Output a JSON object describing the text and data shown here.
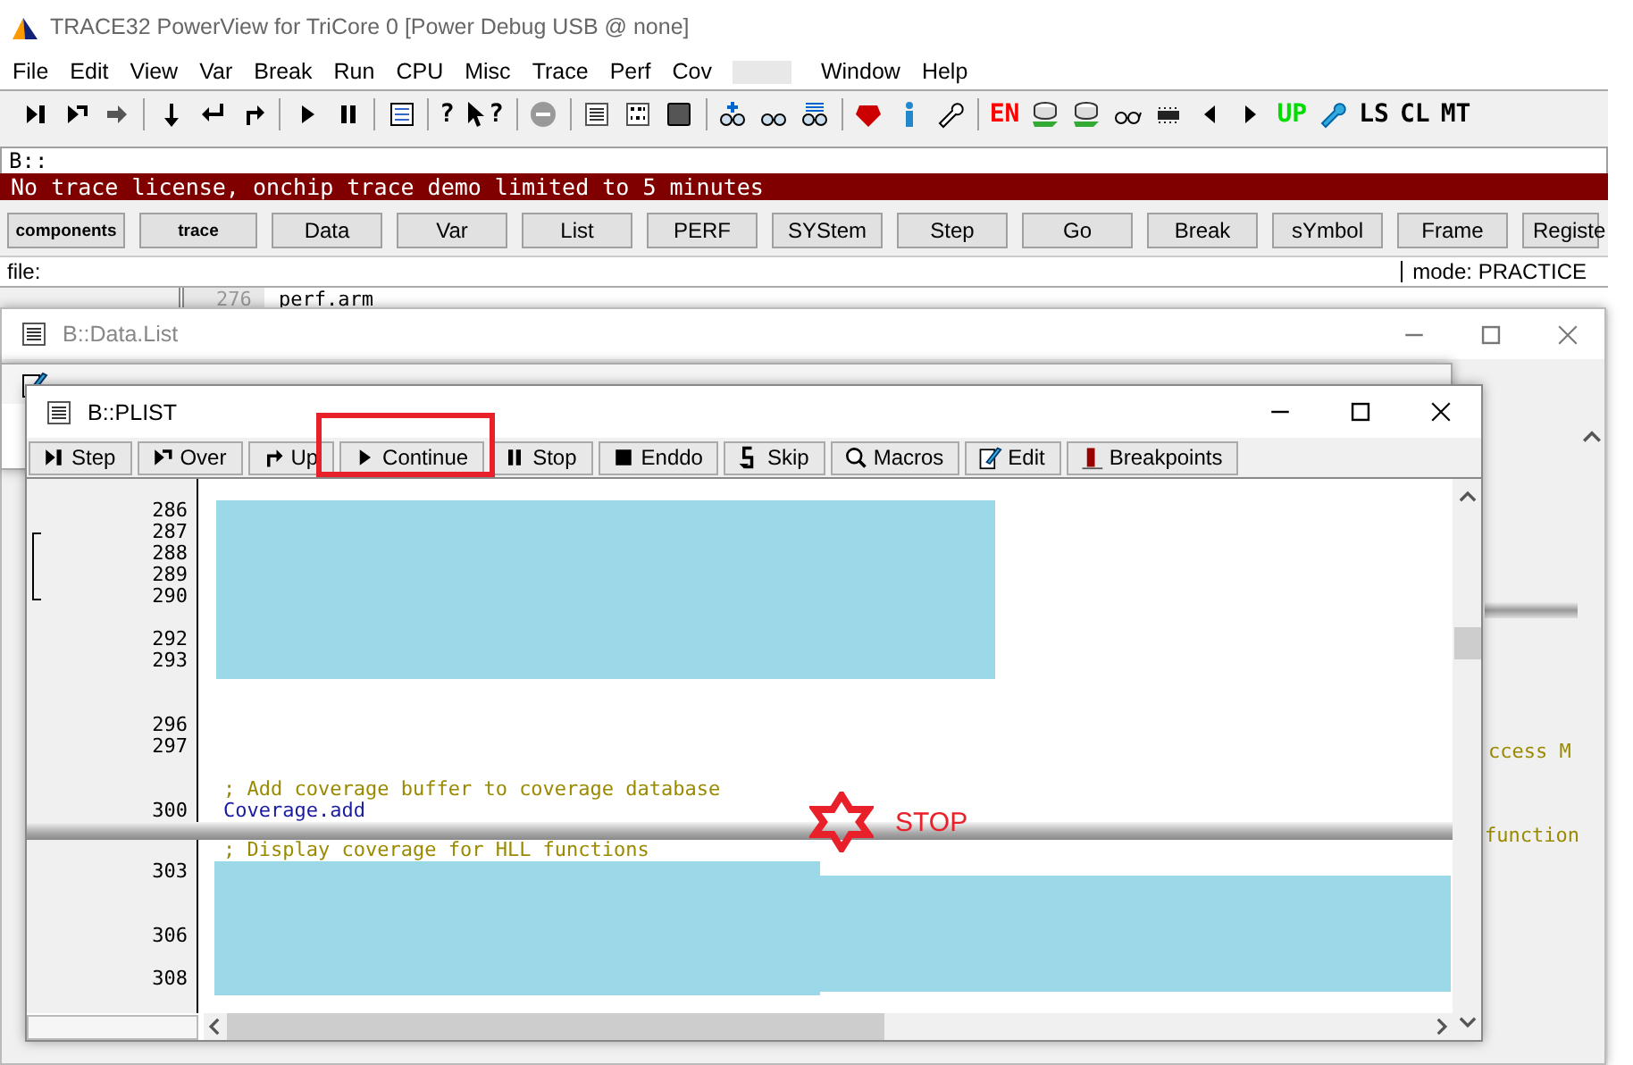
{
  "window": {
    "title": "TRACE32 PowerView for TriCore 0 [Power Debug USB @ none]"
  },
  "menu": [
    {
      "kind": "text",
      "label": "File"
    },
    {
      "kind": "text",
      "label": "Edit"
    },
    {
      "kind": "text",
      "label": "View"
    },
    {
      "kind": "text",
      "label": "Var"
    },
    {
      "kind": "text",
      "label": "Break"
    },
    {
      "kind": "text",
      "label": "Run"
    },
    {
      "kind": "text",
      "label": "CPU"
    },
    {
      "kind": "text",
      "label": "Misc"
    },
    {
      "kind": "text",
      "label": "Trace"
    },
    {
      "kind": "text",
      "label": "Perf"
    },
    {
      "kind": "text",
      "label": "Cov"
    },
    {
      "kind": "redacted"
    },
    {
      "kind": "text",
      "label": "Window"
    },
    {
      "kind": "text",
      "label": "Help"
    }
  ],
  "toolbar_labels": [
    {
      "label": "?",
      "color": "#000000"
    },
    {
      "label": "?",
      "color": "#000000"
    },
    {
      "label": "EN",
      "color": "#ff0000"
    },
    {
      "label": "UP",
      "color": "#00dd00"
    },
    {
      "label": "LS",
      "color": "#000000"
    },
    {
      "label": "CL",
      "color": "#000000"
    },
    {
      "label": "MT",
      "color": "#000000"
    }
  ],
  "command_line": {
    "value": "B::"
  },
  "message": "No trace license, onchip trace demo limited to 5 minutes",
  "buttons": [
    {
      "label": "components",
      "kind": "small"
    },
    {
      "label": "trace",
      "kind": "small"
    },
    {
      "label": "Data",
      "kind": "normal"
    },
    {
      "label": "Var",
      "kind": "normal"
    },
    {
      "label": "List",
      "kind": "normal"
    },
    {
      "label": "PERF",
      "kind": "normal"
    },
    {
      "label": "SYStem",
      "kind": "normal"
    },
    {
      "label": "Step",
      "kind": "normal"
    },
    {
      "label": "Go",
      "kind": "normal"
    },
    {
      "label": "Break",
      "kind": "normal"
    },
    {
      "label": "sYmbol",
      "kind": "normal"
    },
    {
      "label": "Frame",
      "kind": "normal"
    },
    {
      "label": "Registe",
      "kind": "normal"
    }
  ],
  "status_bar": {
    "file": "file:",
    "mode": "mode: PRACTICE"
  },
  "background_listing": {
    "line_number": "276",
    "code": "perf.arm"
  },
  "data_list_window": {
    "title": "B::Data.List",
    "texts": [
      "ccess M",
      "function"
    ]
  },
  "plist_window": {
    "title": "B::PLIST",
    "buttons": [
      {
        "label": "Step",
        "highlighted": false
      },
      {
        "label": "Over",
        "highlighted": false
      },
      {
        "label": "Up",
        "highlighted": false
      },
      {
        "label": "Continue",
        "highlighted": true
      },
      {
        "label": "Stop",
        "highlighted": false
      },
      {
        "label": "Enddo",
        "highlighted": false
      },
      {
        "label": "Skip",
        "highlighted": false
      },
      {
        "label": "Macros",
        "highlighted": false
      },
      {
        "label": "Edit",
        "highlighted": false
      },
      {
        "label": "Breakpoints",
        "highlighted": false
      }
    ],
    "upper_lines": [
      {
        "number": "286"
      },
      {
        "number": "287"
      },
      {
        "number": "288"
      },
      {
        "number": "289"
      },
      {
        "number": "290"
      },
      {
        "kind": "blank"
      },
      {
        "number": "292"
      },
      {
        "number": "293"
      },
      {
        "kind": "blank"
      },
      {
        "kind": "blank"
      },
      {
        "number": "296"
      },
      {
        "number": "297"
      },
      {
        "kind": "blank"
      },
      {
        "kind": "comment",
        "text": "; Add coverage buffer to coverage database"
      },
      {
        "number": "300",
        "kind": "code",
        "text": "Coverage.add"
      }
    ],
    "lower_lines": [
      {
        "kind": "comment",
        "text": "; Display coverage for HLL functions"
      },
      {
        "number": "303"
      },
      {
        "kind": "blank"
      },
      {
        "kind": "blank"
      },
      {
        "number": "306"
      },
      {
        "kind": "blank"
      },
      {
        "number": "308"
      }
    ],
    "stop_marker": {
      "label": "STOP"
    }
  }
}
